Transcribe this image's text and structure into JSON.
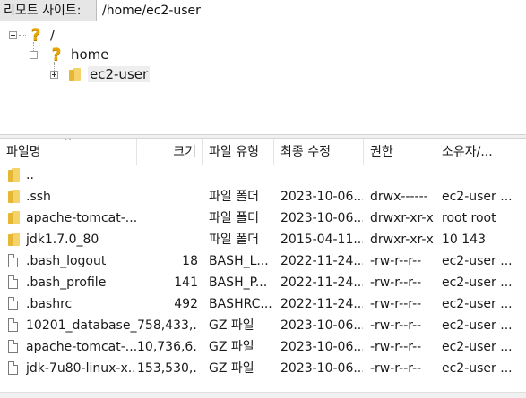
{
  "remote_site": {
    "label": "리모트 사이트:",
    "path": "/home/ec2-user"
  },
  "tree": {
    "root": {
      "label": "/",
      "icon": "question-folder-icon"
    },
    "home": {
      "label": "home",
      "icon": "question-folder-icon"
    },
    "child": {
      "label": "ec2-user",
      "icon": "folder-icon",
      "selected": true
    }
  },
  "columns": {
    "name": "파일명",
    "size": "크기",
    "type": "파일 유형",
    "modified": "최종 수정",
    "perms": "권한",
    "owner": "소유자/..."
  },
  "files": [
    {
      "icon": "folder",
      "name": "..",
      "size": "",
      "type": "",
      "modified": "",
      "perms": "",
      "owner": ""
    },
    {
      "icon": "folder",
      "name": ".ssh",
      "size": "",
      "type": "파일 폴더",
      "modified": "2023-10-06...",
      "perms": "drwx------",
      "owner": "ec2-user ..."
    },
    {
      "icon": "folder",
      "name": "apache-tomcat-...",
      "size": "",
      "type": "파일 폴더",
      "modified": "2023-10-06...",
      "perms": "drwxr-xr-x",
      "owner": "root root"
    },
    {
      "icon": "folder",
      "name": "jdk1.7.0_80",
      "size": "",
      "type": "파일 폴더",
      "modified": "2015-04-11...",
      "perms": "drwxr-xr-x",
      "owner": "10 143"
    },
    {
      "icon": "file",
      "name": ".bash_logout",
      "size": "18",
      "type": "BASH_L...",
      "modified": "2022-11-24...",
      "perms": "-rw-r--r--",
      "owner": "ec2-user ..."
    },
    {
      "icon": "file",
      "name": ".bash_profile",
      "size": "141",
      "type": "BASH_P...",
      "modified": "2022-11-24...",
      "perms": "-rw-r--r--",
      "owner": "ec2-user ..."
    },
    {
      "icon": "file",
      "name": ".bashrc",
      "size": "492",
      "type": "BASHRC...",
      "modified": "2022-11-24...",
      "perms": "-rw-r--r--",
      "owner": "ec2-user ..."
    },
    {
      "icon": "file",
      "name": "10201_database_...",
      "size": "758,433,...",
      "type": "GZ 파일",
      "modified": "2023-10-06...",
      "perms": "-rw-r--r--",
      "owner": "ec2-user ..."
    },
    {
      "icon": "file",
      "name": "apache-tomcat-...",
      "size": "10,736,6...",
      "type": "GZ 파일",
      "modified": "2023-10-06...",
      "perms": "-rw-r--r--",
      "owner": "ec2-user ..."
    },
    {
      "icon": "file",
      "name": "jdk-7u80-linux-x...",
      "size": "153,530,...",
      "type": "GZ 파일",
      "modified": "2023-10-06...",
      "perms": "-rw-r--r--",
      "owner": "ec2-user ..."
    }
  ],
  "colors": {
    "folder_light": "#f5d36a",
    "folder_dark": "#e6b733",
    "question": "#e8a400",
    "selected_bg": "#eeeeee"
  }
}
